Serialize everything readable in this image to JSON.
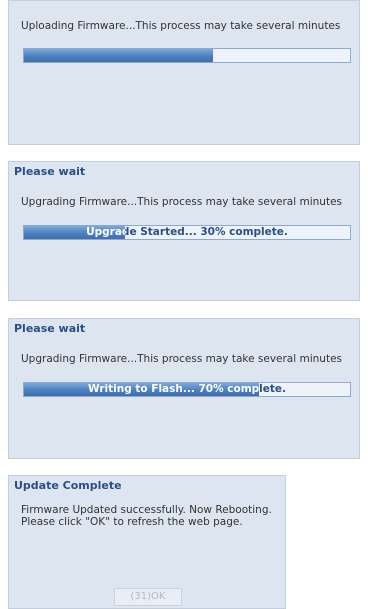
{
  "dialogs": [
    {
      "title": "",
      "message": "Uploading Firmware...This process may take several minutes",
      "progress_fraction": 0.58,
      "progress_text": ""
    },
    {
      "title": "Please wait",
      "message": "Upgrading Firmware...This process may take several minutes",
      "progress_fraction": 0.31,
      "progress_text": "Upgrade Started... 30% complete."
    },
    {
      "title": "Please wait",
      "message": "Upgrading Firmware...This process may take several minutes",
      "progress_fraction": 0.72,
      "progress_text": "Writing to Flash... 70% complete."
    },
    {
      "title": "Update Complete",
      "message": "Firmware Updated successfully. Now Rebooting. Please click \"OK\" to refresh the web page.",
      "button_label": "(31)OK"
    }
  ],
  "colors": {
    "panel_background": "#dde5f0",
    "title_text": "#2a4f86",
    "progress_fill": "#4c7fbf"
  }
}
